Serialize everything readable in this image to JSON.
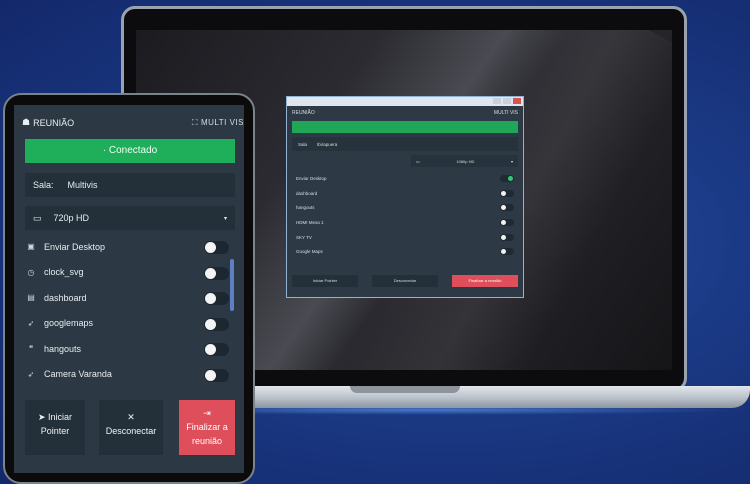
{
  "app": {
    "title": "REUNIÃO",
    "brand": "MULTI VIS"
  },
  "status": {
    "label": "Conectado",
    "prefix": "·",
    "color": "#1fae5a"
  },
  "room": {
    "label": "Sala:",
    "value": "Multivis"
  },
  "resolution": {
    "value": "720p HD"
  },
  "sources": [
    {
      "icon": "desktop-icon",
      "glyph": "▣",
      "label": "Enviar Desktop",
      "enabled": false
    },
    {
      "icon": "clock-icon",
      "glyph": "◷",
      "label": "clock_svg",
      "enabled": false
    },
    {
      "icon": "dashboard-icon",
      "glyph": "▤",
      "label": "dashboard",
      "enabled": false
    },
    {
      "icon": "rocket-icon",
      "glyph": "➶",
      "label": "googlemaps",
      "enabled": false
    },
    {
      "icon": "hangouts-icon",
      "glyph": "❝",
      "label": "hangouts",
      "enabled": false
    },
    {
      "icon": "rocket-icon",
      "glyph": "➶",
      "label": "Camera Varanda",
      "enabled": false
    }
  ],
  "actions": {
    "pointer": {
      "line1": "Iniciar",
      "line2": "Pointer"
    },
    "disconnect": {
      "label": "Desconectar"
    },
    "finish": {
      "line1": "Finalizar a",
      "line2": "reunião",
      "color": "#de4e5b"
    }
  },
  "laptop_window": {
    "title": "REUNIÃO",
    "brand": "MULTI VIS",
    "sala_label": "Sala",
    "sala_value": "Ibirapuera",
    "resolution": "1080p HD",
    "sources": [
      {
        "label": "Enviar Desktop",
        "enabled": true
      },
      {
        "label": "dashboard",
        "enabled": false
      },
      {
        "label": "hangouts",
        "enabled": false
      },
      {
        "label": "HDMI Mesa 1",
        "enabled": false
      },
      {
        "label": "SKY TV",
        "enabled": false
      },
      {
        "label": "Google Maps",
        "enabled": false
      }
    ],
    "actions": {
      "pointer": "Iniciar Pointer",
      "disconnect": "Desconectar",
      "finish": "Finalizar a reunião"
    }
  }
}
